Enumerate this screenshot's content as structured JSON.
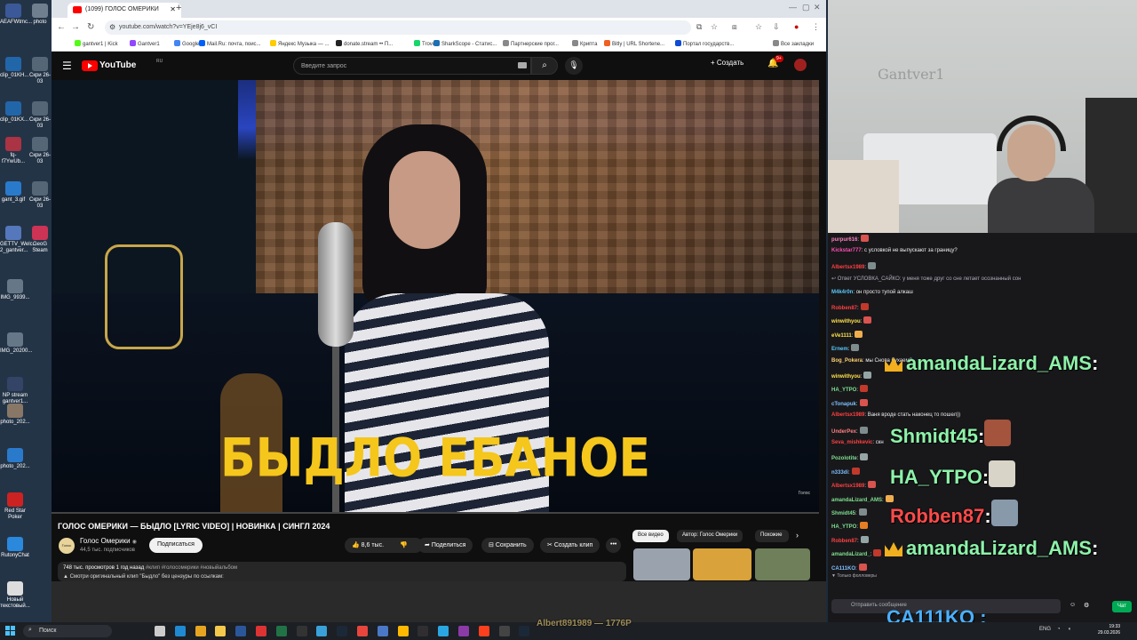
{
  "desktop": {
    "icons": [
      {
        "label": "AEAFWtmc...",
        "color": "#3b5998"
      },
      {
        "label": "photo",
        "color": "#6f7f8f"
      },
      {
        "label": "clip_01KH...",
        "color": "#2266aa"
      },
      {
        "label": "Скри 26-03",
        "color": "#556677"
      },
      {
        "label": "clip_01KX...",
        "color": "#2266aa"
      },
      {
        "label": "Скри 26-03",
        "color": "#556677"
      },
      {
        "label": "fq-f7YwUb...",
        "color": "#aa3344"
      },
      {
        "label": "Скри 26-03",
        "color": "#556677"
      },
      {
        "label": "gant_3.gif",
        "color": "#2a7acc"
      },
      {
        "label": "Скри 26-03",
        "color": "#556677"
      },
      {
        "label": "GETTV_Welc... 2_gantver...",
        "color": "#5577bb"
      },
      {
        "label": "GeoG Steam",
        "color": "#cc3355"
      },
      {
        "label": "IMG_9939...",
        "color": "#667788"
      },
      {
        "label": "IMG_20200...",
        "color": "#667788"
      },
      {
        "label": "NP stream gantver1...",
        "color": "#334466"
      },
      {
        "label": "photo_202...",
        "color": "#887766"
      },
      {
        "label": "photo_202...",
        "color": "#2a7acc"
      },
      {
        "label": "Red Star Poker",
        "color": "#cc2222"
      },
      {
        "label": "RutonyChat",
        "color": "#2a88dd"
      },
      {
        "label": "Новый текстовый...",
        "color": "#dddddd"
      }
    ]
  },
  "browser": {
    "tab_title": "(1099) ГОЛОС ОМЕРИКИ",
    "new_tab": "+",
    "url": "youtube.com/watch?v=YEje8j6_vCI",
    "bookmarks": [
      {
        "label": "gantver1 | Kick",
        "color": "#53fc18"
      },
      {
        "label": "Gantver1",
        "color": "#9147ff"
      },
      {
        "label": "Google",
        "color": "#4285f4"
      },
      {
        "label": "Mail.Ru: почта, поис...",
        "color": "#005ff9"
      },
      {
        "label": "Яндекс Музыка — ...",
        "color": "#ffcc00"
      },
      {
        "label": "donate.stream •• П...",
        "color": "#222222"
      },
      {
        "label": "Trovo",
        "color": "#19d66b"
      },
      {
        "label": "SharkScope - Статис...",
        "color": "#1a6fb5"
      },
      {
        "label": "Партнерские прог...",
        "color": "#888888"
      },
      {
        "label": "Криптa",
        "color": "#888888"
      },
      {
        "label": "Bitly | URL Shortene...",
        "color": "#ee6123"
      },
      {
        "label": "Портал государств...",
        "color": "#0d4cd3"
      },
      {
        "label": "Все закладки",
        "color": "#888888"
      }
    ]
  },
  "youtube": {
    "logo_text": "YouTube",
    "logo_region": "RU",
    "search_placeholder": "Введите запрос",
    "create_label": "Создать",
    "notif_count": "9+",
    "subtitle": "БЫДЛО ЕБАНОЕ",
    "video_watermark": "Голос",
    "video_title": "ГОЛОС ОМЕРИКИ — БЫДЛО [LYRIC VIDEO] | НОВИНКА | СИНГЛ 2024",
    "channel_logo_text": "Голос",
    "channel_name": "Голос Омерики",
    "channel_subs": "44,5 тыс. подписчиков",
    "subscribe": "Подписаться",
    "likes": "8,6 тыс.",
    "share": "Поделиться",
    "save": "Сохранить",
    "clip": "Создать клип",
    "more": "•••",
    "views_line": "748 тыс. просмотров  1 год назад",
    "tags": "#клип #голосомерики #новыйальбом",
    "desc_line": "▲ Смотри оригинальный клип \"Быдло\" без цензуры по ссылкам:",
    "chips": [
      "Все видео",
      "Автор: Голос Омерики",
      "Похожие"
    ]
  },
  "chat": {
    "lines": [
      {
        "user": "purpur616",
        "text": ":",
        "color": "#ff7fbf"
      },
      {
        "user": "Kickstar777",
        "text": ": с условкой не выпускают за границу?",
        "color": "#ff4fb0"
      },
      {
        "user": "Albertsx1989",
        "text": ":",
        "color": "#ff4040"
      },
      {
        "user": "",
        "text": "↩ Ответ УСЛОВКА_САЙКО: у меня тоже друг со сне летает осознанный сон",
        "color": "#adadb8"
      },
      {
        "user": "M4k4r0n",
        "text": ": он просто тупой алкаш",
        "color": "#5ac8fa"
      },
      {
        "user": "Robben87",
        "text": ":",
        "color": "#ff4040"
      },
      {
        "user": "winwithyou",
        "text": ":",
        "color": "#ffe24a"
      },
      {
        "user": "eVe1111",
        "text": ":",
        "color": "#ffe24a"
      },
      {
        "user": "Ernem",
        "text": ":",
        "color": "#5ac8fa"
      },
      {
        "user": "Bog_Pokera",
        "text": ": мы Снова бухаем?",
        "color": "#ffcf6f"
      },
      {
        "user": "winwithyou",
        "text": ":",
        "color": "#ffe24a"
      },
      {
        "user": "HA_YTPO",
        "text": ":",
        "color": "#7fe08f"
      },
      {
        "user": "cTonapuk",
        "text": ":",
        "color": "#7fc0ff"
      },
      {
        "user": "Albertsx1989",
        "text": ": Ваня вроде стать наконец то пошел))",
        "color": "#ff4040"
      },
      {
        "user": "UnderPex",
        "text": ":",
        "color": "#ff7f7f"
      },
      {
        "user": "Seva_mishkevic",
        "text": ": скн",
        "color": "#ff4040"
      },
      {
        "user": "Pozolotite",
        "text": ":",
        "color": "#7fe08f"
      },
      {
        "user": "n333di",
        "text": ":",
        "color": "#7fc0ff"
      },
      {
        "user": "Albertsx1989",
        "text": ":",
        "color": "#ff4040"
      },
      {
        "user": "amandaLizard_AMS",
        "text": ":",
        "color": "#7fe08f"
      },
      {
        "user": "Shmidt45",
        "text": ":",
        "color": "#7fe08f"
      },
      {
        "user": "HA_YTPO",
        "text": ":",
        "color": "#7fe08f"
      },
      {
        "user": "Robben87",
        "text": ":",
        "color": "#ff4040"
      },
      {
        "user": "amandaLizard_",
        "text": ":",
        "color": "#7fe08f"
      },
      {
        "user": "CA111KO",
        "text": ":",
        "color": "#7fc0ff"
      }
    ],
    "big_lines": [
      {
        "user": "amandaLizard_AMS",
        "text": ":",
        "color": "#8df2a9"
      },
      {
        "user": "Shmidt45",
        "text": ":",
        "color": "#8df2a9"
      },
      {
        "user": "HA_YTPO",
        "text": ":",
        "color": "#8df2a9"
      },
      {
        "user": "Robben87",
        "text": ":",
        "color": "#ff4a4a"
      },
      {
        "user": "amandaLizard_AMS",
        "text": ":",
        "color": "#8df2a9"
      }
    ],
    "only_followers": "▼ Только фолловеры",
    "send_placeholder": "Отправить сообщение",
    "chat_button": "Чат",
    "overlay_name": "CA111KO",
    "overlay_colon": ":",
    "webcam_mural": "Gantver1"
  },
  "taskbar": {
    "search": "Поиск",
    "overlay_donor": "Albert891989 — 1776P",
    "lang": "ENG",
    "time": "19:33",
    "date": "29.03.2026",
    "apps": [
      {
        "name": "task-view",
        "color": "#cccccc"
      },
      {
        "name": "edge",
        "color": "#1f8ad2"
      },
      {
        "name": "paint",
        "color": "#e6a420"
      },
      {
        "name": "explorer",
        "color": "#f3c84b"
      },
      {
        "name": "word",
        "color": "#2b579a"
      },
      {
        "name": "app-64",
        "color": "#d33"
      },
      {
        "name": "excel",
        "color": "#217346"
      },
      {
        "name": "app-black",
        "color": "#333"
      },
      {
        "name": "chrome-alt",
        "color": "#3aa0d8"
      },
      {
        "name": "steam-app",
        "color": "#1b2838"
      },
      {
        "name": "chrome",
        "color": "#e8453c"
      },
      {
        "name": "calc",
        "color": "#4a78c6"
      },
      {
        "name": "files",
        "color": "#ffb900"
      },
      {
        "name": "obs",
        "color": "#302e31"
      },
      {
        "name": "telegram",
        "color": "#2aa7e2"
      },
      {
        "name": "purple-app",
        "color": "#8c3aa8"
      },
      {
        "name": "yandex",
        "color": "#fc3f1d"
      },
      {
        "name": "app-h",
        "color": "#444"
      },
      {
        "name": "steam",
        "color": "#1b2838"
      }
    ]
  }
}
